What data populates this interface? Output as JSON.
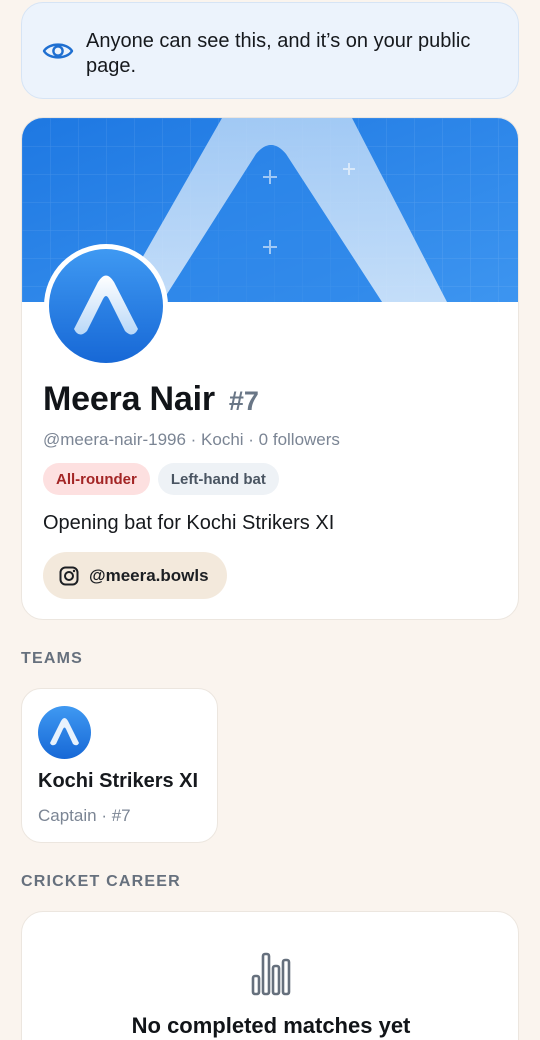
{
  "visibility_notice": {
    "icon": "eye-icon",
    "text": "Anyone can see this, and it’s on your public page."
  },
  "profile": {
    "name": "Meera Nair",
    "number": "#7",
    "meta": "@meera-nair-1996 · Kochi · 0 followers",
    "tags": [
      "All-rounder",
      "Left-hand bat"
    ],
    "bio": "Opening bat for Kochi Strikers XI",
    "social": {
      "icon": "instagram-icon",
      "handle": "@meera.bowls"
    }
  },
  "teams": {
    "heading": "TEAMS",
    "items": [
      {
        "name": "Kochi Strikers XI",
        "role": "Captain · #7"
      }
    ]
  },
  "career": {
    "heading": "CRICKET CAREER",
    "icon": "bar-chart-icon",
    "empty_title": "No completed matches yet"
  },
  "colors": {
    "accent": "#1f7fe5",
    "page_bg": "#faf4ee",
    "role_tag": "#fde0e0",
    "social_pill": "#f3e9dc"
  }
}
